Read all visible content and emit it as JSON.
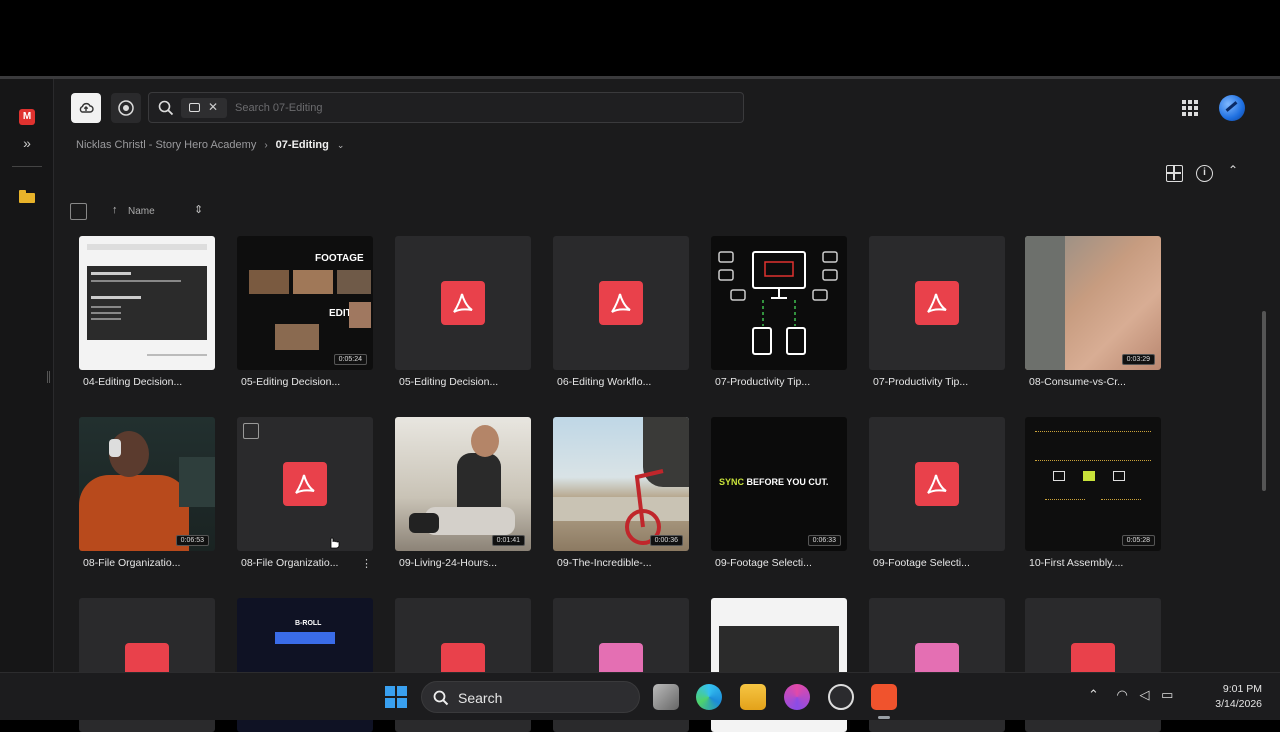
{
  "toolbar": {
    "search_placeholder": "Search 07-Editing"
  },
  "breadcrumb": {
    "root": "Nicklas Christl - Story Hero Academy",
    "current": "07-Editing"
  },
  "sort": {
    "label": "Name"
  },
  "grid": {
    "items": [
      {
        "label": "04-Editing Decision...",
        "type": "doc",
        "duration": ""
      },
      {
        "label": "05-Editing Decision...",
        "type": "video",
        "duration": "0:05:24"
      },
      {
        "label": "05-Editing Decision...",
        "type": "pdf",
        "duration": ""
      },
      {
        "label": "06-Editing Workflo...",
        "type": "pdf",
        "duration": ""
      },
      {
        "label": "07-Productivity Tip...",
        "type": "image",
        "duration": ""
      },
      {
        "label": "07-Productivity Tip...",
        "type": "pdf",
        "duration": ""
      },
      {
        "label": "08-Consume-vs-Cr...",
        "type": "video",
        "duration": "0:03:29"
      },
      {
        "label": "08-File Organizatio...",
        "type": "video",
        "duration": "0:06:53"
      },
      {
        "label": "08-File Organizatio...",
        "type": "pdf",
        "duration": ""
      },
      {
        "label": "09-Living-24-Hours...",
        "type": "video",
        "duration": "0:01:41"
      },
      {
        "label": "09-The-Incredible-...",
        "type": "video",
        "duration": "0:00:36"
      },
      {
        "label": "09-Footage Selecti...",
        "type": "video",
        "duration": "0:06:33"
      },
      {
        "label": "09-Footage Selecti...",
        "type": "pdf",
        "duration": ""
      },
      {
        "label": "10-First Assembly....",
        "type": "video",
        "duration": "0:05:28"
      }
    ],
    "sync_text_a": "SYNC",
    "sync_text_b": "BEFORE YOU CUT.",
    "footage_text": "FOOTAGE",
    "edit_text": "EDIT",
    "broll_text": "B-ROLL"
  },
  "taskbar": {
    "search_label": "Search",
    "time": "9:01 PM",
    "date": "3/14/2026"
  },
  "colors": {
    "pdf_red": "#e9414b",
    "video_pink": "#e46fb3",
    "app_bg": "#1b1b1c",
    "accent_blue": "#1e6fe0"
  }
}
